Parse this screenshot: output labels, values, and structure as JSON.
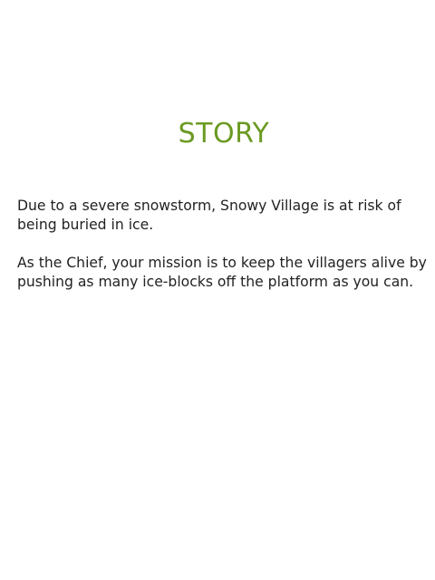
{
  "screen": {
    "title": "STORY",
    "paragraphs": [
      "Due to a severe snowstorm, Snowy Village is at risk of being buried in ice.",
      "As the Chief, your mission is to keep the villagers alive by pushing as many ice-blocks off the platform as you can."
    ]
  },
  "colors": {
    "title": "#6b9a22",
    "text": "#222222",
    "background": "#ffffff"
  }
}
